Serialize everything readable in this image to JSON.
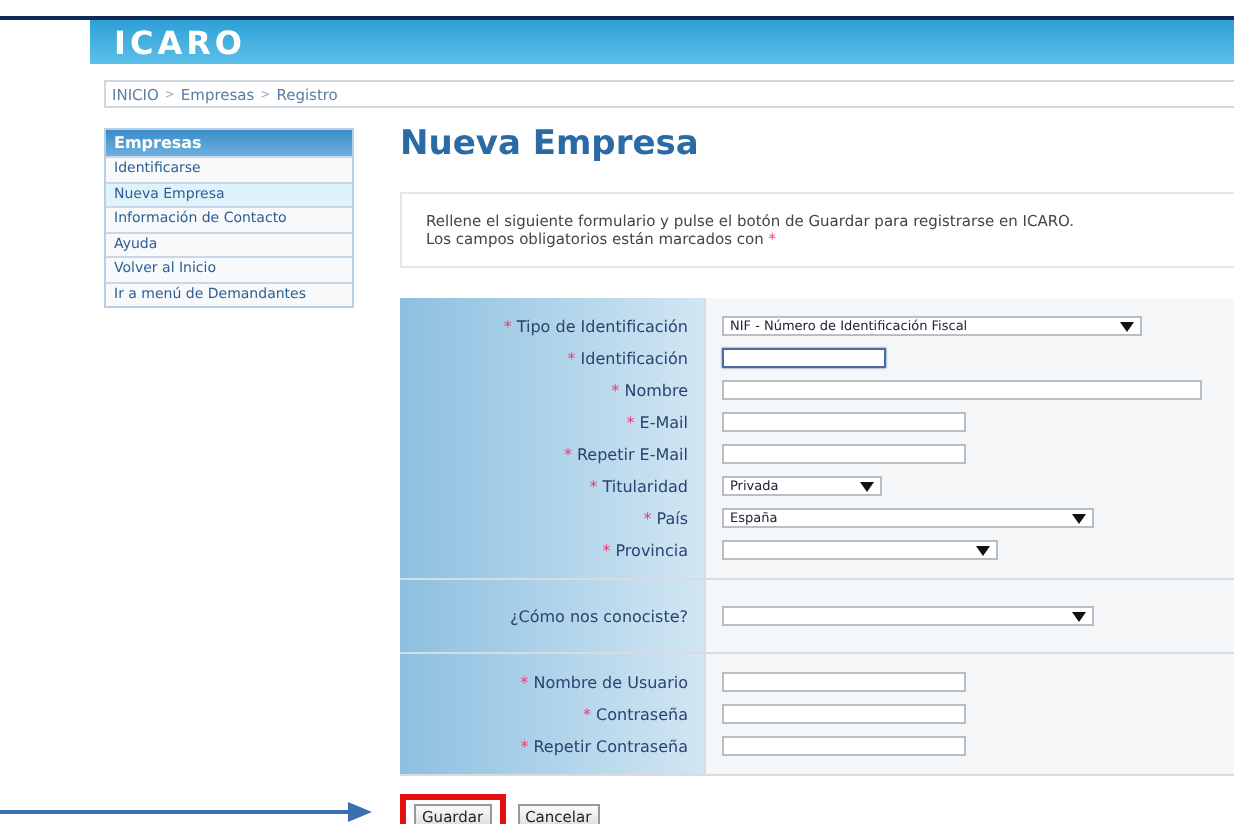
{
  "header": {
    "logo": "ICARO"
  },
  "breadcrumb": [
    "INICIO",
    "Empresas",
    "Registro"
  ],
  "breadcrumb_separator": ">",
  "sidebar": {
    "title": "Empresas",
    "items": [
      {
        "label": "Identificarse",
        "selected": false
      },
      {
        "label": "Nueva Empresa",
        "selected": true
      },
      {
        "label": "Información de Contacto",
        "selected": false
      },
      {
        "label": "Ayuda",
        "selected": false
      },
      {
        "label": "Volver al Inicio",
        "selected": false
      },
      {
        "label": "Ir a menú de Demandantes",
        "selected": false
      }
    ]
  },
  "page_title": "Nueva Empresa",
  "intro": [
    "Rellene el siguiente formulario y pulse el botón de Guardar para registrarse en ICARO.",
    "Los campos obligatorios están marcados con"
  ],
  "required_mark": "*",
  "form_groups": [
    {
      "fields": [
        {
          "label": "Tipo de Identificación",
          "required": true,
          "kind": "select",
          "value": "NIF - Número de Identificación Fiscal",
          "focused": false
        },
        {
          "label": "Identificación",
          "required": true,
          "kind": "text",
          "focused": true
        },
        {
          "label": "Nombre",
          "required": true,
          "kind": "text",
          "focused": false
        },
        {
          "label": "E-Mail",
          "required": true,
          "kind": "text",
          "focused": false
        },
        {
          "label": "Repetir E-Mail",
          "required": true,
          "kind": "text",
          "focused": false
        },
        {
          "label": "Titularidad",
          "required": true,
          "kind": "select",
          "value": "Privada",
          "focused": false
        },
        {
          "label": "País",
          "required": true,
          "kind": "select",
          "value": "España",
          "focused": false
        },
        {
          "label": "Provincia",
          "required": true,
          "kind": "select",
          "focused": false
        }
      ]
    },
    {
      "fields": [
        {
          "label": "¿Cómo nos conociste?",
          "required": false,
          "kind": "select",
          "focused": false
        }
      ]
    },
    {
      "fields": [
        {
          "label": "Nombre de Usuario",
          "required": true,
          "kind": "text",
          "focused": false
        },
        {
          "label": "Contraseña",
          "required": true,
          "kind": "text",
          "focused": false
        },
        {
          "label": "Repetir Contraseña",
          "required": true,
          "kind": "text",
          "focused": false
        }
      ]
    }
  ],
  "buttons": [
    {
      "label": "Guardar",
      "highlighted": true
    },
    {
      "label": "Cancelar",
      "highlighted": false
    }
  ]
}
